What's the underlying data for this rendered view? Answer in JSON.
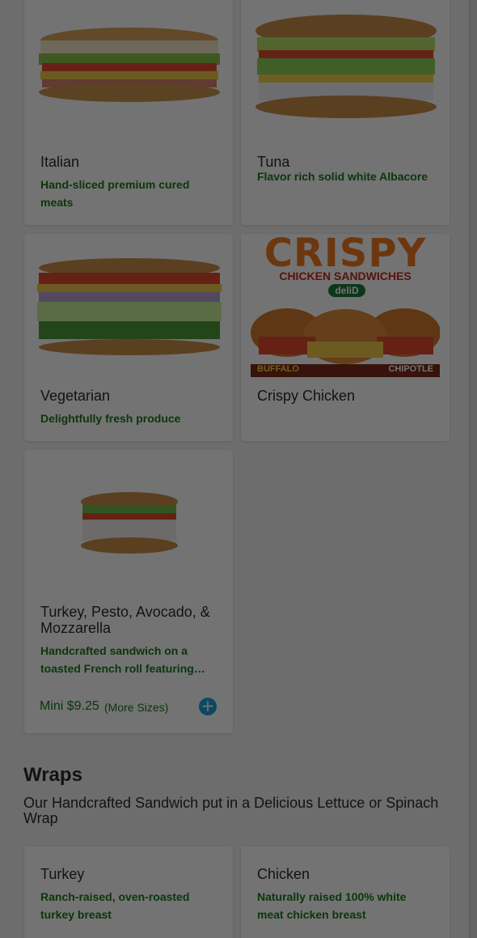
{
  "sandwiches": [
    {
      "name": "Italian",
      "desc": "Hand-sliced premium cured meats"
    },
    {
      "name": "Tuna",
      "desc": "Flavor rich solid white Albacore"
    },
    {
      "name": "Vegetarian",
      "desc": "Delightfully fresh produce"
    },
    {
      "name": "Crispy Chicken",
      "desc": ""
    },
    {
      "name": "Turkey, Pesto, Avocado, & Mozzarella",
      "desc": "Handcrafted sandwich on a toasted French roll featuring…",
      "price": "Mini $9.25",
      "more_sizes": "(More Sizes)"
    }
  ],
  "promo": {
    "headline": "CRISPY",
    "subhead": "CHICKEN SANDWICHES",
    "brand": "deliD",
    "left_label": "BUFFALO",
    "right_label": "CHIPOTLE"
  },
  "wraps": {
    "title": "Wraps",
    "subtitle": "Our Handcrafted Sandwich put in a Delicious Lettuce or Spinach Wrap",
    "items": [
      {
        "name": "Turkey",
        "desc": "Ranch-raised, oven-roasted turkey breast"
      },
      {
        "name": "Chicken",
        "desc": "Naturally raised 100% white meat chicken breast"
      }
    ]
  },
  "icons": {
    "add": "plus-circle-icon"
  },
  "colors": {
    "accent_green": "#1a7a1a",
    "add_button": "#1c9fd8",
    "overlay": "rgba(0,0,0,0.55)"
  }
}
